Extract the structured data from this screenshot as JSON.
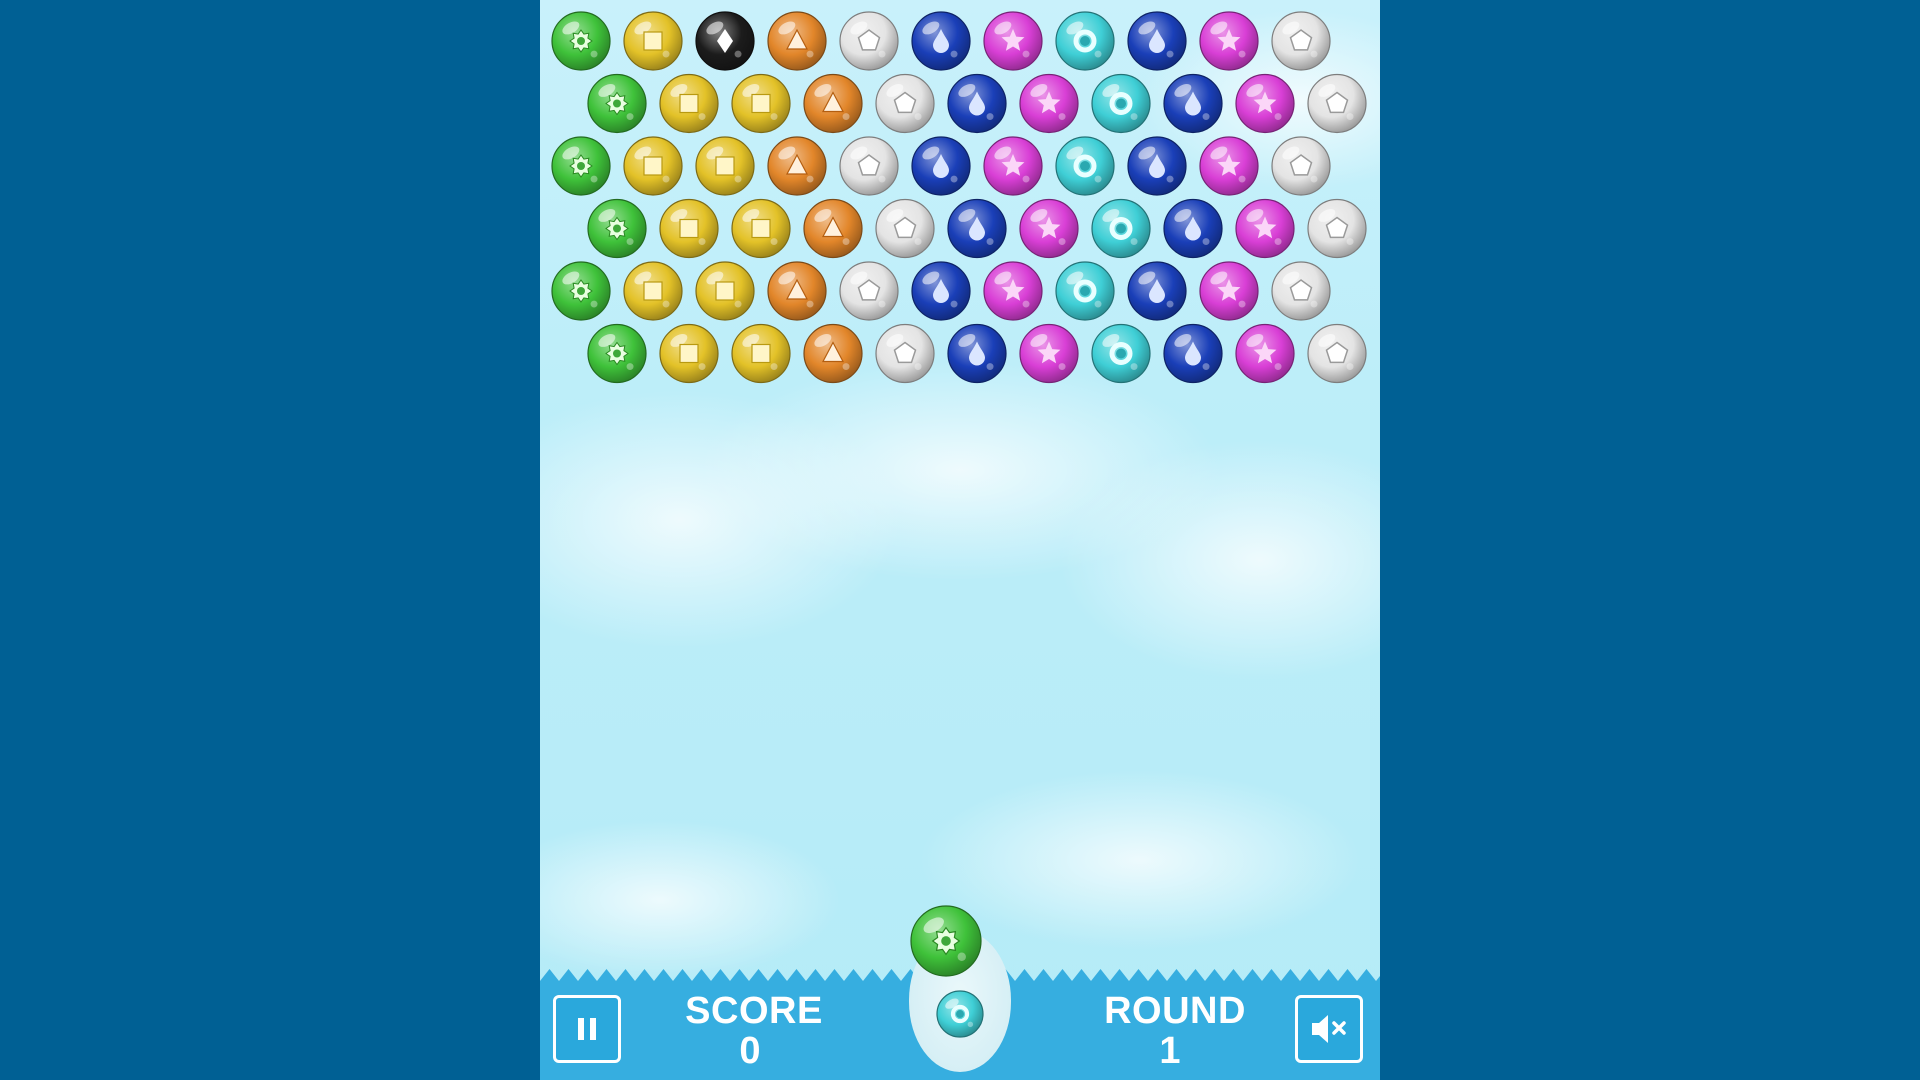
{
  "hud": {
    "score_label": "SCORE",
    "score_value": "0",
    "round_label": "ROUND",
    "round_value": "1",
    "pause_icon": "pause-icon",
    "mute_icon": "speaker-muted-icon"
  },
  "colors": {
    "page_background": "#006094",
    "sky_top": "#c9f1fb",
    "hud_bar": "#36aee0",
    "green": "#3fc23a",
    "yellow": "#e3c228",
    "black": "#1c1c1c",
    "orange": "#e2862a",
    "white": "#e4e4e4",
    "blue": "#1a3fb8",
    "magenta": "#d93fd6",
    "teal": "#3fcfd6"
  },
  "bubble_symbols": {
    "green": "star-burst",
    "yellow": "square",
    "black": "diamond",
    "orange": "triangle",
    "white": "pentagon",
    "blue": "drop",
    "magenta": "star",
    "teal": "ring"
  },
  "grid": {
    "rows": [
      [
        "green",
        "yellow",
        "black",
        "orange",
        "white",
        "blue",
        "magenta",
        "teal",
        "blue",
        "magenta",
        "white"
      ],
      [
        "green",
        "yellow",
        "yellow",
        "orange",
        "white",
        "blue",
        "magenta",
        "teal",
        "blue",
        "magenta",
        "white"
      ],
      [
        "green",
        "yellow",
        "yellow",
        "orange",
        "white",
        "blue",
        "magenta",
        "teal",
        "blue",
        "magenta",
        "white"
      ],
      [
        "green",
        "yellow",
        "yellow",
        "orange",
        "white",
        "blue",
        "magenta",
        "teal",
        "blue",
        "magenta",
        "white"
      ],
      [
        "green",
        "yellow",
        "yellow",
        "orange",
        "white",
        "blue",
        "magenta",
        "teal",
        "blue",
        "magenta",
        "white"
      ],
      [
        "green",
        "yellow",
        "yellow",
        "orange",
        "white",
        "blue",
        "magenta",
        "teal",
        "blue",
        "magenta",
        "white"
      ]
    ]
  },
  "shooter": {
    "current": "green",
    "next": "teal"
  }
}
